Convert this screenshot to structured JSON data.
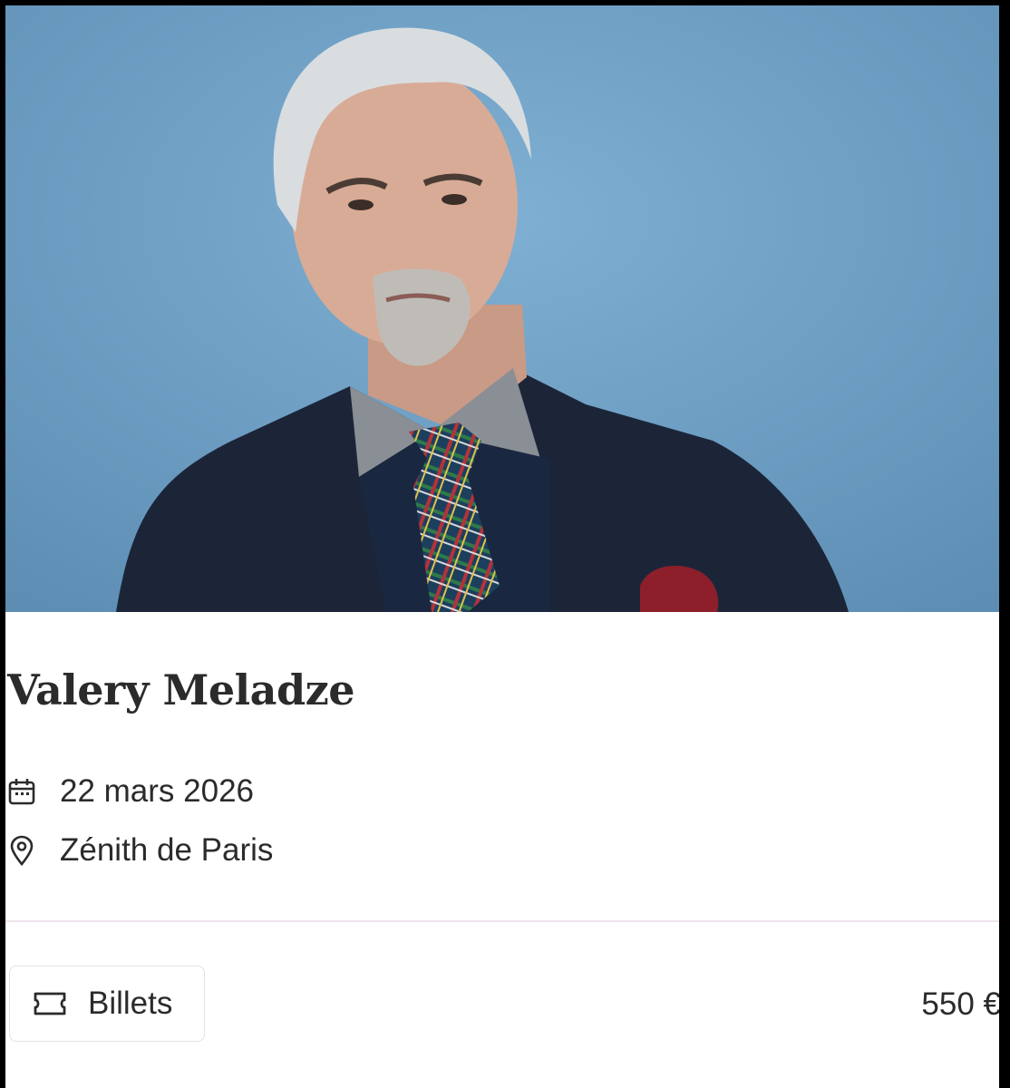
{
  "event": {
    "artist_photo_icon": "portrait-photo",
    "title": "Valery Meladze",
    "date_icon": "calendar-icon",
    "date": "22 mars 2026",
    "venue_icon": "map-pin-icon",
    "venue": "Zénith de Paris"
  },
  "tickets": {
    "icon": "ticket-icon",
    "button_label": "Billets",
    "price": "550 €"
  },
  "colors": {
    "photo_background": "#6f9fc2",
    "text": "#2b2b2b",
    "divider": "#f1e3ee"
  }
}
